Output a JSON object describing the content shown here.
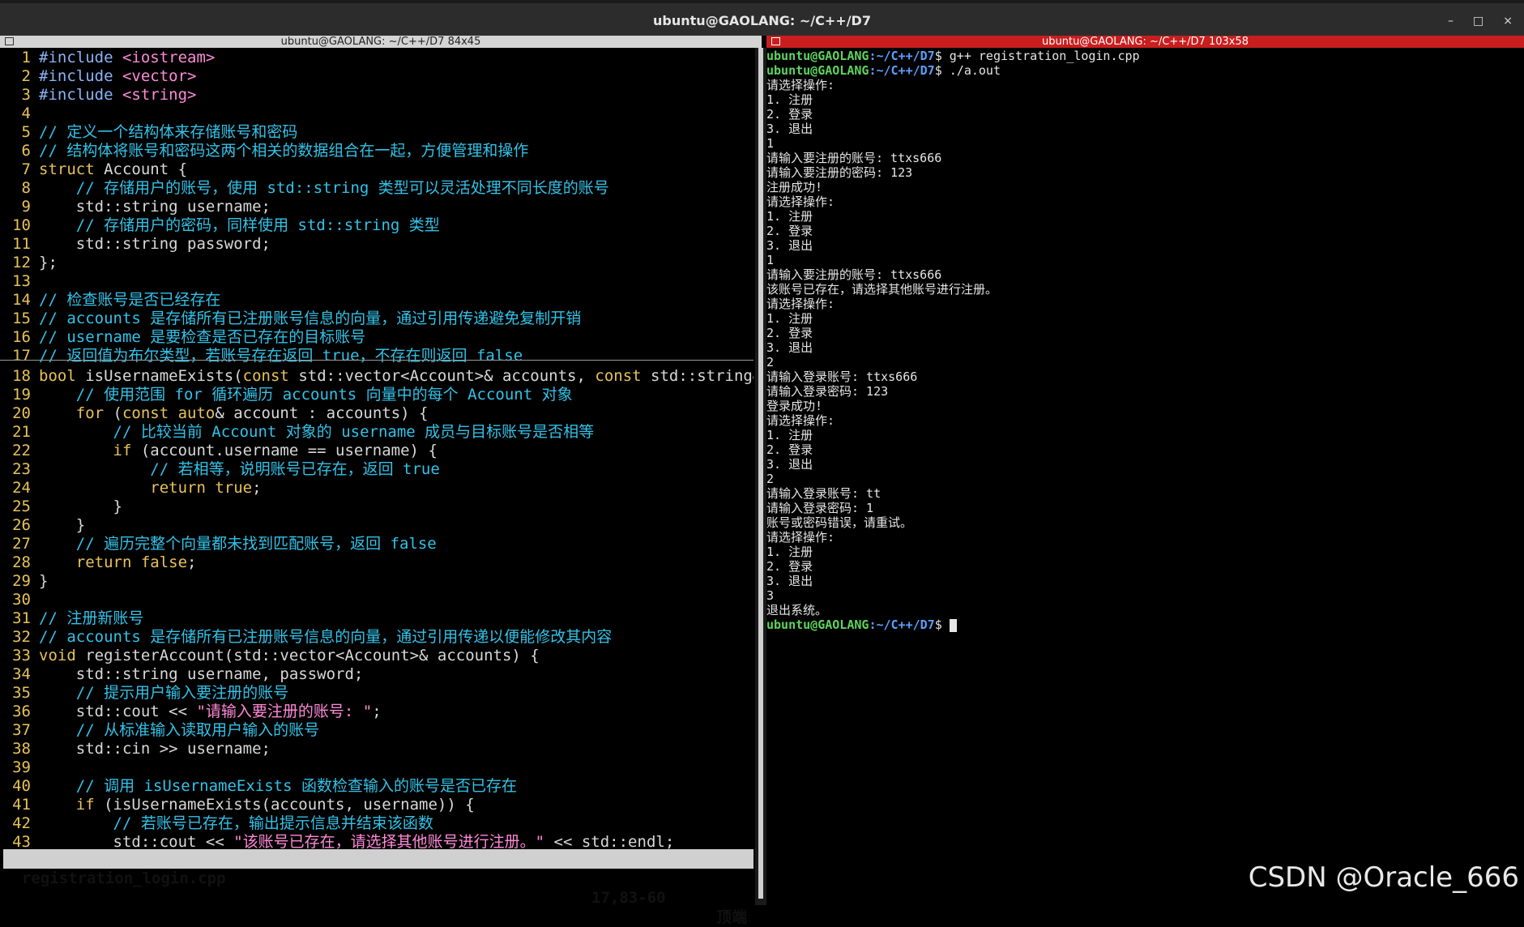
{
  "window": {
    "title": "ubuntu@GAOLANG: ~/C++/D7",
    "minimize": "–",
    "maximize": "□",
    "close": "×"
  },
  "left_pane": {
    "header": "ubuntu@GAOLANG: ~/C++/D7 84x45",
    "lines": [
      [
        [
          "pre",
          "#include "
        ],
        [
          "str",
          "<iostream>"
        ]
      ],
      [
        [
          "pre",
          "#include "
        ],
        [
          "str",
          "<vector>"
        ]
      ],
      [
        [
          "pre",
          "#include "
        ],
        [
          "str",
          "<string>"
        ]
      ],
      [],
      [
        [
          "cm",
          "// 定义一个结构体来存储账号和密码"
        ]
      ],
      [
        [
          "cm",
          "// 结构体将账号和密码这两个相关的数据组合在一起，方便管理和操作"
        ]
      ],
      [
        [
          "kw",
          "struct"
        ],
        [
          "tx",
          " Account {"
        ]
      ],
      [
        [
          "cm",
          "    // 存储用户的账号，使用 std::string 类型可以灵活处理不同长度的账号"
        ]
      ],
      [
        [
          "tx",
          "    std::string username;"
        ]
      ],
      [
        [
          "cm",
          "    // 存储用户的密码，同样使用 std::string 类型"
        ]
      ],
      [
        [
          "tx",
          "    std::string password;"
        ]
      ],
      [
        [
          "tx",
          "};"
        ]
      ],
      [],
      [
        [
          "cm",
          "// 检查账号是否已经存在"
        ]
      ],
      [
        [
          "cm",
          "// accounts 是存储所有已注册账号信息的向量，通过引用传递避免复制开销"
        ]
      ],
      [
        [
          "cm",
          "// username 是要检查是否已存在的目标账号"
        ]
      ],
      [
        [
          "cm",
          "// 返回值为布尔类型，若账号存在返回 true，不存在则返回 false"
        ]
      ],
      [
        [
          "kw",
          "bool"
        ],
        [
          "tx",
          " isUsernameExists("
        ],
        [
          "kw",
          "const"
        ],
        [
          "tx",
          " std::vector<Account>& accounts, "
        ],
        [
          "kw",
          "const"
        ],
        [
          "tx",
          " std::string& u"
        ]
      ],
      [
        [
          "cm",
          "    // 使用范围 for 循环遍历 accounts 向量中的每个 Account 对象"
        ]
      ],
      [
        [
          "kw",
          "    for"
        ],
        [
          "tx",
          " ("
        ],
        [
          "kw",
          "const auto"
        ],
        [
          "tx",
          "& account : accounts) {"
        ]
      ],
      [
        [
          "cm",
          "        // 比较当前 Account 对象的 username 成员与目标账号是否相等"
        ]
      ],
      [
        [
          "kw",
          "        if"
        ],
        [
          "tx",
          " (account.username == username) {"
        ]
      ],
      [
        [
          "cm",
          "            // 若相等，说明账号已存在，返回 true"
        ]
      ],
      [
        [
          "kw",
          "            return"
        ],
        [
          "tx",
          " "
        ],
        [
          "kw",
          "true"
        ],
        [
          "tx",
          ";"
        ]
      ],
      [
        [
          "tx",
          "        }"
        ]
      ],
      [
        [
          "tx",
          "    }"
        ]
      ],
      [
        [
          "cm",
          "    // 遍历完整个向量都未找到匹配账号，返回 false"
        ]
      ],
      [
        [
          "kw",
          "    return"
        ],
        [
          "tx",
          " "
        ],
        [
          "kw",
          "false"
        ],
        [
          "tx",
          ";"
        ]
      ],
      [
        [
          "tx",
          "}"
        ]
      ],
      [],
      [
        [
          "cm",
          "// 注册新账号"
        ]
      ],
      [
        [
          "cm",
          "// accounts 是存储所有已注册账号信息的向量，通过引用传递以便能修改其内容"
        ]
      ],
      [
        [
          "kw",
          "void"
        ],
        [
          "tx",
          " registerAccount(std::vector<Account>& accounts) {"
        ]
      ],
      [
        [
          "tx",
          "    std::string username, password;"
        ]
      ],
      [
        [
          "cm",
          "    // 提示用户输入要注册的账号"
        ]
      ],
      [
        [
          "tx",
          "    std::cout << "
        ],
        [
          "str",
          "\"请输入要注册的账号: \""
        ],
        [
          "tx",
          ";"
        ]
      ],
      [
        [
          "cm",
          "    // 从标准输入读取用户输入的账号"
        ]
      ],
      [
        [
          "tx",
          "    std::cin >> username;"
        ]
      ],
      [],
      [
        [
          "cm",
          "    // 调用 isUsernameExists 函数检查输入的账号是否已存在"
        ]
      ],
      [
        [
          "kw",
          "    if"
        ],
        [
          "tx",
          " (isUsernameExists(accounts, username)) {"
        ]
      ],
      [
        [
          "cm",
          "        // 若账号已存在，输出提示信息并结束该函数"
        ]
      ],
      [
        [
          "tx",
          "        std::cout << "
        ],
        [
          "str",
          "\"该账号已存在，请选择其他账号进行注册。\""
        ],
        [
          "tx",
          " << std::endl;"
        ]
      ]
    ],
    "status": {
      "filename": "registration_login.cpp",
      "position": "17,83-60",
      "scroll": "顶端"
    }
  },
  "right_pane": {
    "header": "ubuntu@GAOLANG: ~/C++/D7 103x58",
    "prompt_user": "ubuntu@GAOLANG",
    "prompt_path": ":~/C++/D7",
    "lines": [
      {
        "p": true,
        "cmd": "$ g++ registration_login.cpp"
      },
      {
        "p": true,
        "cmd": "$ ./a.out"
      },
      {
        "t": "请选择操作:"
      },
      {
        "t": "1. 注册"
      },
      {
        "t": "2. 登录"
      },
      {
        "t": "3. 退出"
      },
      {
        "t": "1"
      },
      {
        "t": "请输入要注册的账号: ttxs666"
      },
      {
        "t": "请输入要注册的密码: 123"
      },
      {
        "t": "注册成功!"
      },
      {
        "t": "请选择操作:"
      },
      {
        "t": "1. 注册"
      },
      {
        "t": "2. 登录"
      },
      {
        "t": "3. 退出"
      },
      {
        "t": "1"
      },
      {
        "t": "请输入要注册的账号: ttxs666"
      },
      {
        "t": "该账号已存在，请选择其他账号进行注册。"
      },
      {
        "t": "请选择操作:"
      },
      {
        "t": "1. 注册"
      },
      {
        "t": "2. 登录"
      },
      {
        "t": "3. 退出"
      },
      {
        "t": "2"
      },
      {
        "t": "请输入登录账号: ttxs666"
      },
      {
        "t": "请输入登录密码: 123"
      },
      {
        "t": "登录成功!"
      },
      {
        "t": "请选择操作:"
      },
      {
        "t": "1. 注册"
      },
      {
        "t": "2. 登录"
      },
      {
        "t": "3. 退出"
      },
      {
        "t": "2"
      },
      {
        "t": "请输入登录账号: tt"
      },
      {
        "t": "请输入登录密码: 1"
      },
      {
        "t": "账号或密码错误，请重试。"
      },
      {
        "t": "请选择操作:"
      },
      {
        "t": "1. 注册"
      },
      {
        "t": "2. 登录"
      },
      {
        "t": "3. 退出"
      },
      {
        "t": "3"
      },
      {
        "t": "退出系统。"
      },
      {
        "p": true,
        "cmd": "$ ",
        "cursor": true
      }
    ]
  },
  "watermark": "CSDN @Oracle_666"
}
